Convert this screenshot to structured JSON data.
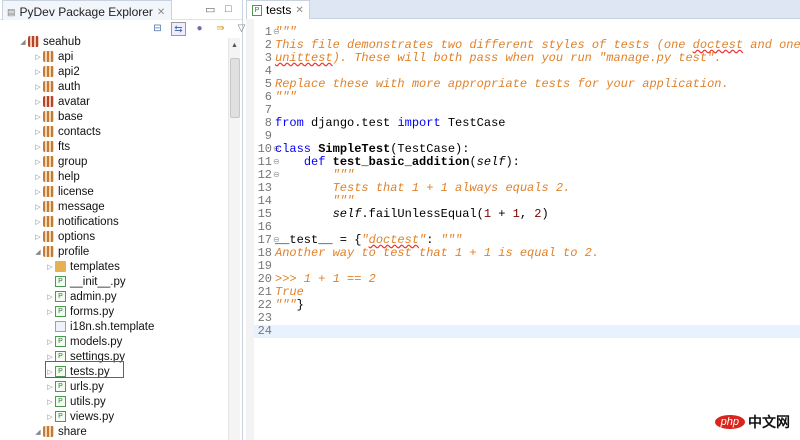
{
  "explorer": {
    "title": "PyDev Package Explorer",
    "tree": [
      {
        "label": "seahub",
        "level": 0,
        "icon": "project",
        "arrow": "open"
      },
      {
        "label": "api",
        "level": 1,
        "icon": "package",
        "arrow": "closed"
      },
      {
        "label": "api2",
        "level": 1,
        "icon": "package",
        "arrow": "closed"
      },
      {
        "label": "auth",
        "level": 1,
        "icon": "package",
        "arrow": "closed"
      },
      {
        "label": "avatar",
        "level": 1,
        "icon": "project",
        "arrow": "closed"
      },
      {
        "label": "base",
        "level": 1,
        "icon": "package",
        "arrow": "closed"
      },
      {
        "label": "contacts",
        "level": 1,
        "icon": "package",
        "arrow": "closed"
      },
      {
        "label": "fts",
        "level": 1,
        "icon": "package",
        "arrow": "closed"
      },
      {
        "label": "group",
        "level": 1,
        "icon": "package",
        "arrow": "closed"
      },
      {
        "label": "help",
        "level": 1,
        "icon": "package",
        "arrow": "closed"
      },
      {
        "label": "license",
        "level": 1,
        "icon": "package",
        "arrow": "closed"
      },
      {
        "label": "message",
        "level": 1,
        "icon": "package",
        "arrow": "closed"
      },
      {
        "label": "notifications",
        "level": 1,
        "icon": "package",
        "arrow": "closed"
      },
      {
        "label": "options",
        "level": 1,
        "icon": "package",
        "arrow": "closed"
      },
      {
        "label": "profile",
        "level": 1,
        "icon": "package",
        "arrow": "open"
      },
      {
        "label": "templates",
        "level": 2,
        "icon": "folder",
        "arrow": "closed"
      },
      {
        "label": "__init__.py",
        "level": 2,
        "icon": "python-file",
        "arrow": "none"
      },
      {
        "label": "admin.py",
        "level": 2,
        "icon": "python-file",
        "arrow": "closed"
      },
      {
        "label": "forms.py",
        "level": 2,
        "icon": "python-file",
        "arrow": "closed"
      },
      {
        "label": "i18n.sh.template",
        "level": 2,
        "icon": "text-file",
        "arrow": "none"
      },
      {
        "label": "models.py",
        "level": 2,
        "icon": "python-file",
        "arrow": "closed"
      },
      {
        "label": "settings.py",
        "level": 2,
        "icon": "python-file",
        "arrow": "closed"
      },
      {
        "label": "tests.py",
        "level": 2,
        "icon": "python-file",
        "arrow": "closed",
        "highlighted": true
      },
      {
        "label": "urls.py",
        "level": 2,
        "icon": "python-file",
        "arrow": "closed"
      },
      {
        "label": "utils.py",
        "level": 2,
        "icon": "python-file",
        "arrow": "closed"
      },
      {
        "label": "views.py",
        "level": 2,
        "icon": "python-file",
        "arrow": "closed"
      },
      {
        "label": "share",
        "level": 1,
        "icon": "package",
        "arrow": "open"
      }
    ]
  },
  "editor": {
    "tab": "tests",
    "current_line": 24,
    "lines": [
      {
        "n": "1",
        "fold": true,
        "tokens": [
          [
            "\"\"\"",
            "cm"
          ]
        ]
      },
      {
        "n": "2",
        "tokens": [
          [
            "This file demonstrates two different styles of tests (one ",
            "cm"
          ],
          [
            "doctest",
            "cm sq"
          ],
          [
            " and one",
            "cm"
          ]
        ]
      },
      {
        "n": "3",
        "tokens": [
          [
            "unittest",
            "cm sq"
          ],
          [
            "). These will both pass when you run \"manage.py test\".",
            "cm"
          ]
        ]
      },
      {
        "n": "4",
        "tokens": []
      },
      {
        "n": "5",
        "tokens": [
          [
            "Replace these with more appropriate tests for your application.",
            "cm"
          ]
        ]
      },
      {
        "n": "6",
        "tokens": [
          [
            "\"\"\"",
            "cm"
          ]
        ]
      },
      {
        "n": "7",
        "tokens": []
      },
      {
        "n": "8",
        "tokens": [
          [
            "from",
            "kw"
          ],
          [
            " django.test ",
            "pl"
          ],
          [
            "import",
            "kw"
          ],
          [
            " TestCase",
            "pl"
          ]
        ]
      },
      {
        "n": "9",
        "tokens": []
      },
      {
        "n": "10",
        "fold": true,
        "tokens": [
          [
            "class",
            "kw"
          ],
          [
            " ",
            "pl"
          ],
          [
            "SimpleTest",
            "fn"
          ],
          [
            "(TestCase):",
            "pl"
          ]
        ]
      },
      {
        "n": "11",
        "fold": true,
        "tokens": [
          [
            "    ",
            "pl"
          ],
          [
            "def",
            "kw"
          ],
          [
            " ",
            "pl"
          ],
          [
            "test_basic_addition",
            "fn"
          ],
          [
            "(",
            "pl"
          ],
          [
            "self",
            "self"
          ],
          [
            "):",
            "pl"
          ]
        ]
      },
      {
        "n": "12",
        "fold": true,
        "tokens": [
          [
            "        \"\"\"",
            "cm"
          ]
        ]
      },
      {
        "n": "13",
        "tokens": [
          [
            "        Tests that 1 + 1 always equals 2.",
            "cm"
          ]
        ]
      },
      {
        "n": "14",
        "tokens": [
          [
            "        \"\"\"",
            "cm"
          ]
        ]
      },
      {
        "n": "15",
        "tokens": [
          [
            "        ",
            "pl"
          ],
          [
            "self",
            "self"
          ],
          [
            ".failUnlessEqual(",
            "pl"
          ],
          [
            "1",
            "num"
          ],
          [
            " + ",
            "pl"
          ],
          [
            "1",
            "num"
          ],
          [
            ", ",
            "pl"
          ],
          [
            "2",
            "num"
          ],
          [
            ")",
            "pl"
          ]
        ]
      },
      {
        "n": "16",
        "tokens": []
      },
      {
        "n": "17",
        "fold": true,
        "tokens": [
          [
            "__test__ = {",
            "pl"
          ],
          [
            "\"",
            "cm"
          ],
          [
            "doctest",
            "cm sq"
          ],
          [
            "\"",
            "cm"
          ],
          [
            ": ",
            "pl"
          ],
          [
            "\"\"\"",
            "cm"
          ]
        ]
      },
      {
        "n": "18",
        "tokens": [
          [
            "Another way to test that 1 + 1 is equal to 2.",
            "cm"
          ]
        ]
      },
      {
        "n": "19",
        "tokens": []
      },
      {
        "n": "20",
        "tokens": [
          [
            ">>> 1 + 1 == 2",
            "cm"
          ]
        ]
      },
      {
        "n": "21",
        "tokens": [
          [
            "True",
            "cm"
          ]
        ]
      },
      {
        "n": "22",
        "tokens": [
          [
            "\"\"\"",
            "cm"
          ],
          [
            "}",
            "pl"
          ]
        ]
      },
      {
        "n": "23",
        "tokens": []
      },
      {
        "n": "24",
        "tokens": []
      }
    ]
  },
  "watermark": {
    "logo": "php",
    "text": "中文网"
  }
}
